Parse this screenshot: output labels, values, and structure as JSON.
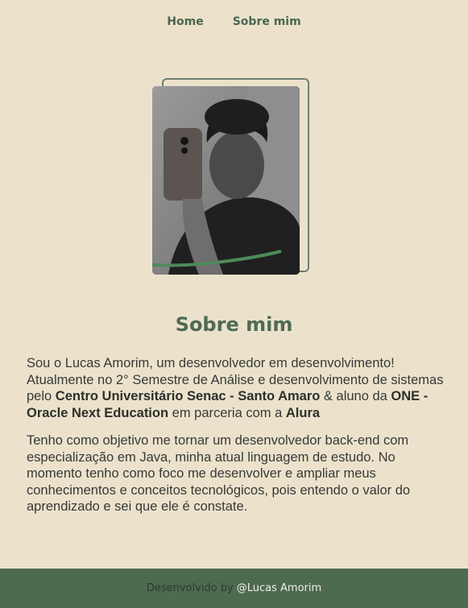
{
  "nav": {
    "home": "Home",
    "about": "Sobre mim"
  },
  "section": {
    "title": "Sobre mim"
  },
  "paragraph1": {
    "t1": "Sou o Lucas Amorim, um desenvolvedor em desenvolvimento! Atualmente no 2° Semestre de Análise e desenvolvimento de sistemas pelo ",
    "b1": "Centro Universitário Senac - Santo Amaro",
    "t2": " & aluno da ",
    "b2": "ONE - Oracle Next Education",
    "t3": " em parceria com a ",
    "b3": "Alura"
  },
  "paragraph2": "Tenho como objetivo me tornar um desenvolvedor back-end com especialização em Java, minha atual linguagem de estudo. No momento tenho como foco me desenvolver e ampliar meus conhecimentos e conceitos tecnológicos, pois entendo o valor do aprendizado e sei que ele é constate.",
  "footer": {
    "prefix": "Desenvolvido by",
    "author": "@Lucas Amorim"
  },
  "colors": {
    "background": "#ece2cc",
    "accent": "#4e6a53",
    "footer": "#4c6b51"
  }
}
